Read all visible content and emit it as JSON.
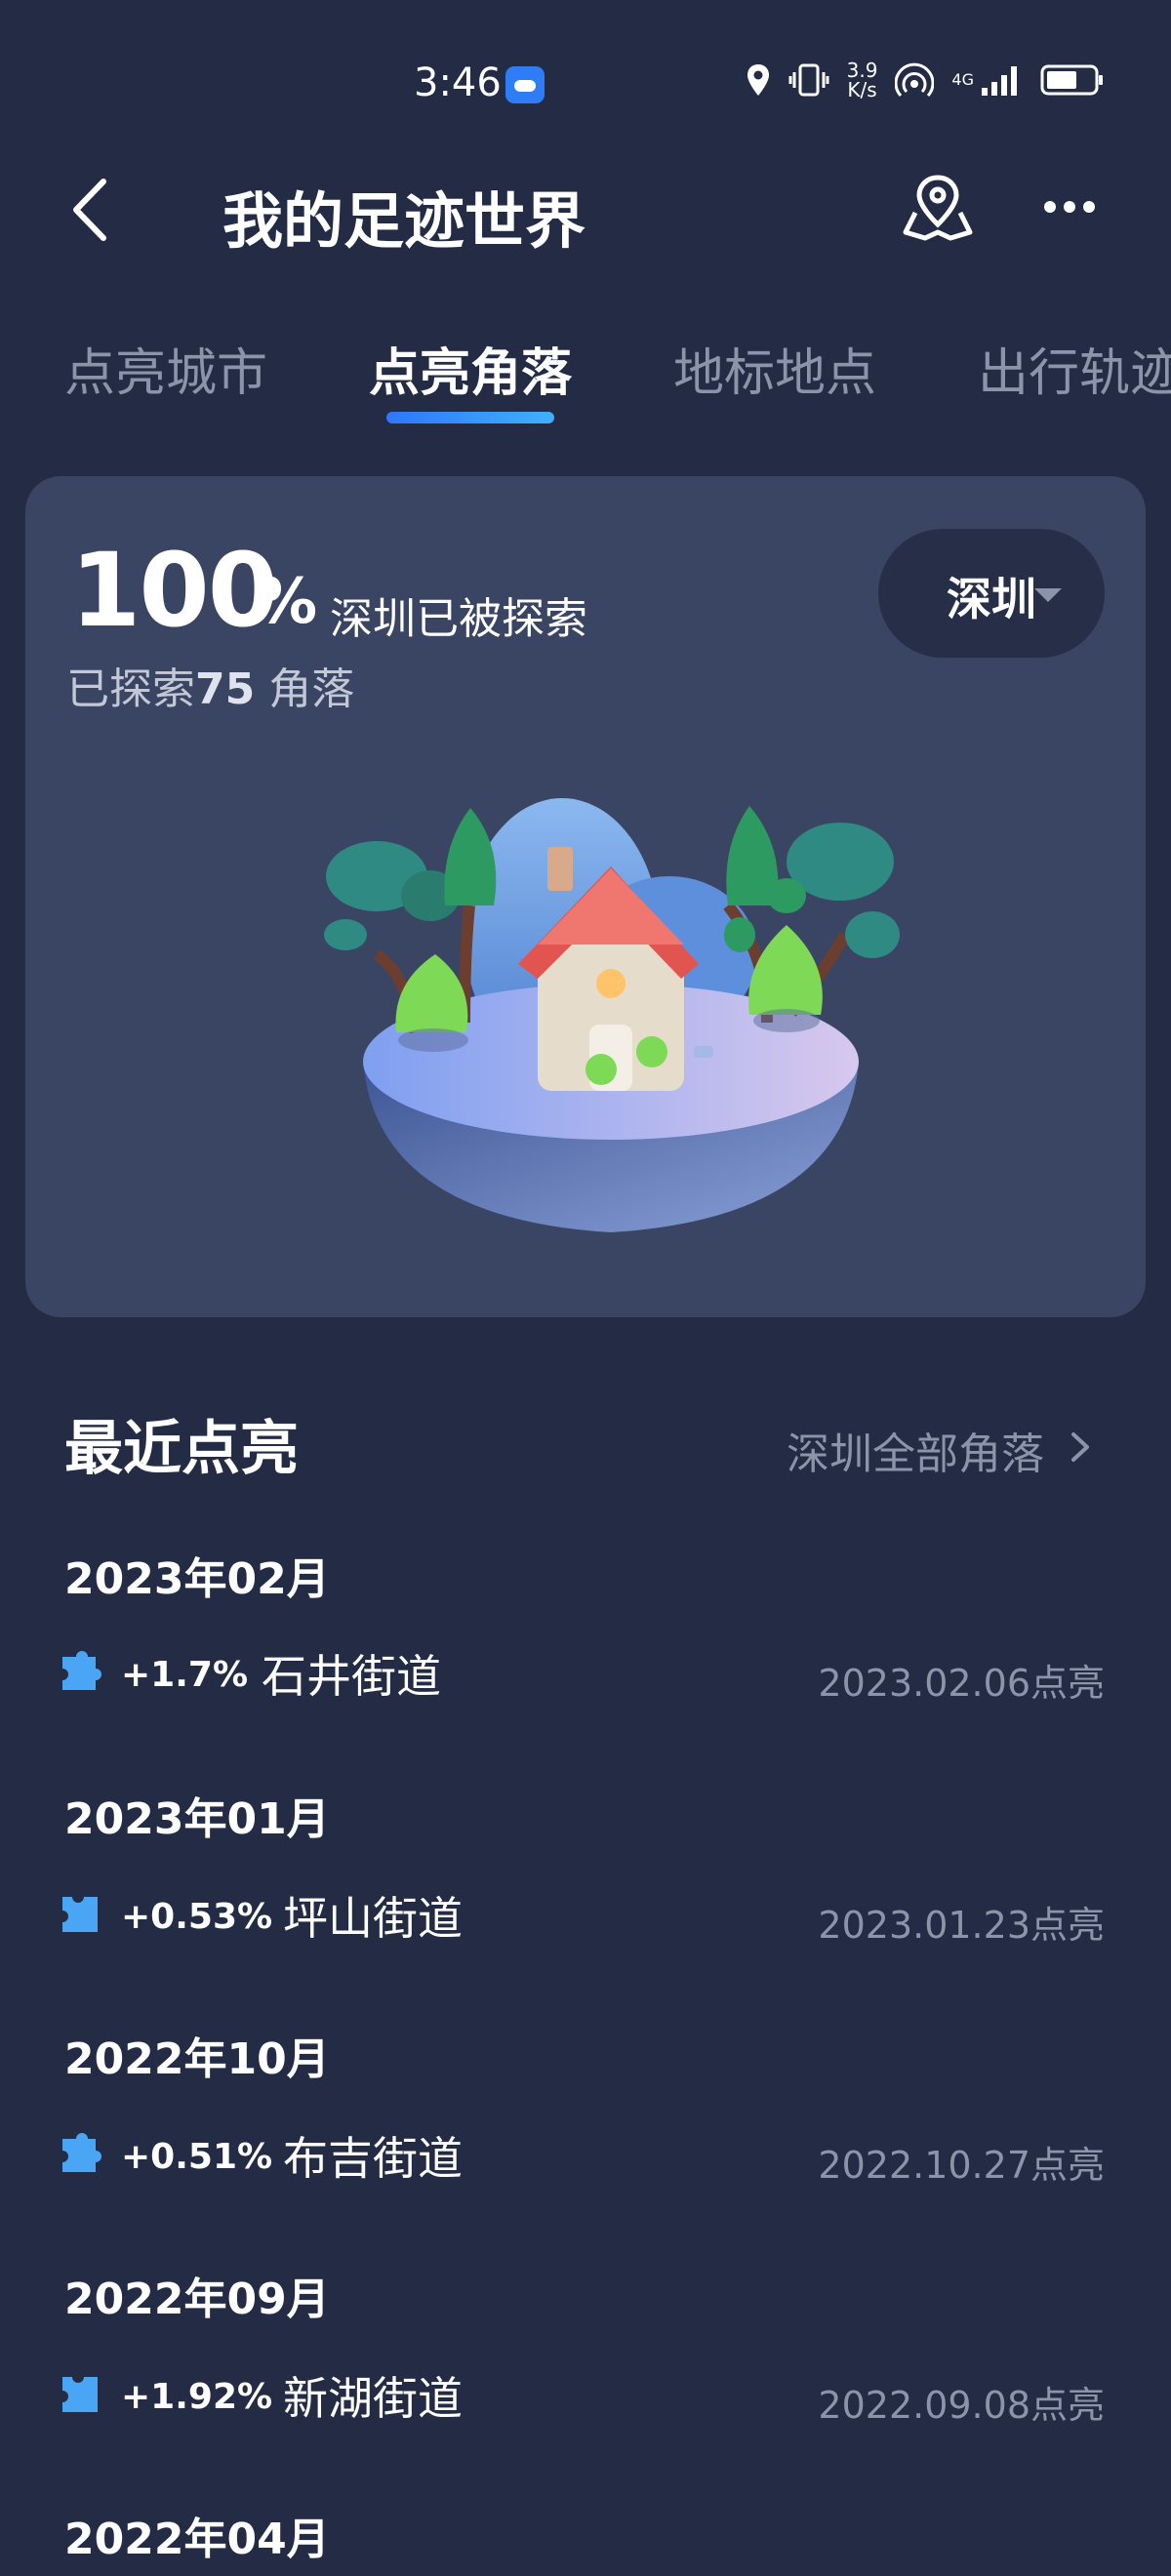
{
  "status_bar": {
    "time": "3:46",
    "speed_value": "3.9",
    "speed_unit": "K/s",
    "network": "4G",
    "icons": [
      "weather-icon",
      "location-icon",
      "vibrate-icon",
      "hotspot-icon",
      "signal-icon",
      "battery-icon"
    ]
  },
  "header": {
    "title": "我的足迹世界",
    "back_icon": "back-arrow-icon",
    "map_icon": "map-pin-icon",
    "more_icon": "more-icon"
  },
  "tabs": [
    {
      "label": "点亮城市",
      "active": false
    },
    {
      "label": "点亮角落",
      "active": true
    },
    {
      "label": "地标地点",
      "active": false
    },
    {
      "label": "出行轨迹",
      "active": false
    }
  ],
  "explore_card": {
    "percent": "100",
    "percent_sign": "%",
    "explored_text": "深圳已被探索",
    "count_prefix": "已探索",
    "count": "75",
    "count_suffix": "角落",
    "city": "深圳"
  },
  "recent": {
    "title": "最近点亮",
    "all_link": "深圳全部角落",
    "groups": [
      {
        "month": "2023年02月",
        "delta": "+1.7%",
        "place": "石井街道",
        "date": "2023.02.06点亮"
      },
      {
        "month": "2023年01月",
        "delta": "+0.53%",
        "place": "坪山街道",
        "date": "2023.01.23点亮"
      },
      {
        "month": "2022年10月",
        "delta": "+0.51%",
        "place": "布吉街道",
        "date": "2022.10.27点亮"
      },
      {
        "month": "2022年09月",
        "delta": "+1.92%",
        "place": "新湖街道",
        "date": "2022.09.08点亮"
      },
      {
        "month": "2022年04月"
      }
    ]
  },
  "colors": {
    "background": "#232c44",
    "card": "#3a4563",
    "accent": "#2e8bff",
    "muted_text": "#8d93a8",
    "puzzle": "#4aa6f5"
  }
}
